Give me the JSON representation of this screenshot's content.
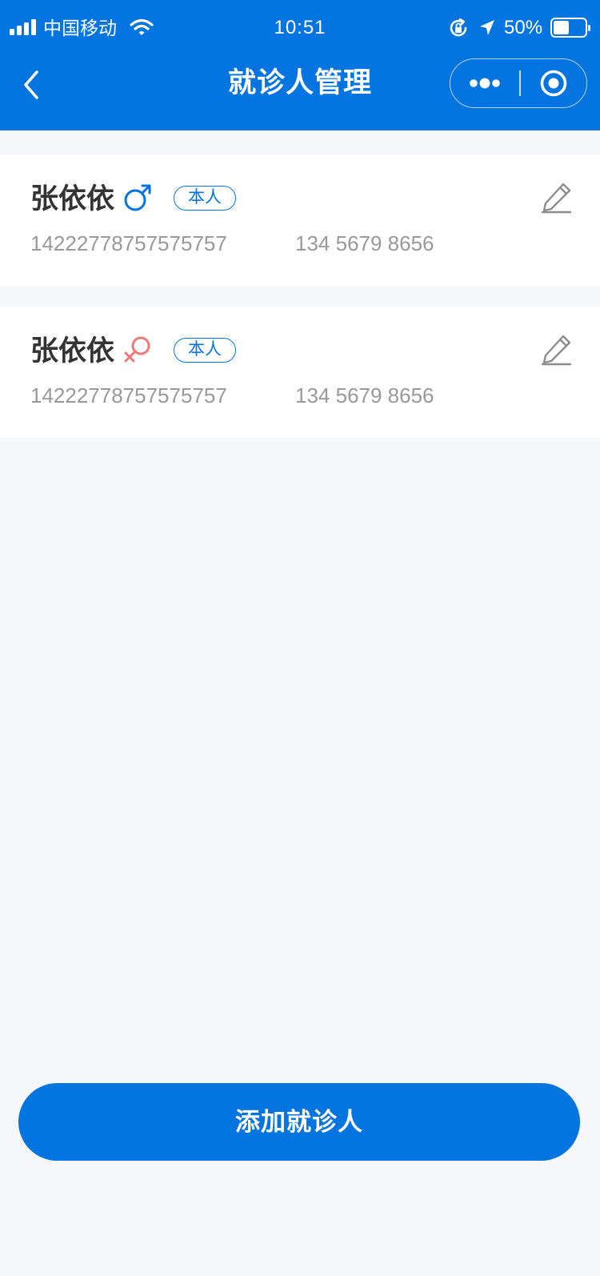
{
  "status_bar": {
    "carrier": "中国移动",
    "time": "10:51",
    "battery": "50%",
    "icons": [
      "signal-icon",
      "wifi-icon",
      "rotation-lock-icon",
      "location-icon",
      "battery-icon"
    ],
    "battery_level": 0.5
  },
  "nav": {
    "title": "就诊人管理",
    "icons": [
      "back-icon",
      "more-icon",
      "close-target-icon"
    ]
  },
  "patients": [
    {
      "name": "张依依",
      "gender": "male",
      "gender_icon": "male-icon",
      "tag": "本人",
      "id_number": "14222778757575757",
      "phone": "134 5679 8656"
    },
    {
      "name": "张依依",
      "gender": "female",
      "gender_icon": "female-icon",
      "tag": "本人",
      "id_number": "14222778757575757",
      "phone": "134 5679 8656"
    }
  ],
  "add_button_label": "添加就诊人",
  "colors": {
    "primary": "#0474e0",
    "male": "#0474e0",
    "female": "#f07878",
    "text": "#333333",
    "secondary_text": "#999999",
    "background": "#f5f7fb"
  }
}
